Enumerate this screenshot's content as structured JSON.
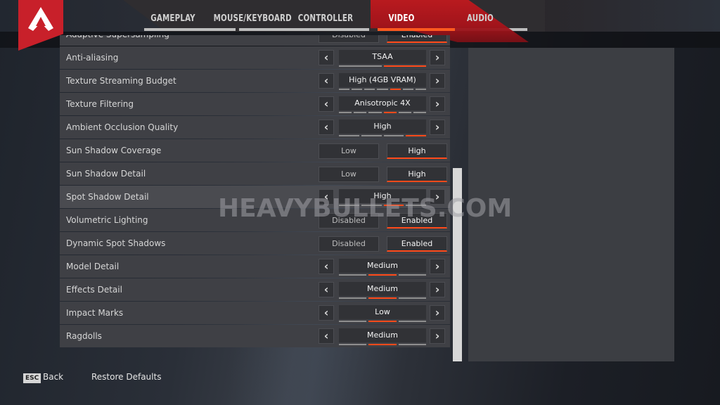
{
  "colors": {
    "accent": "#ff4a1a",
    "brand_red": "#c8202a",
    "row_bg": "#3f4045",
    "control_bg": "#313236"
  },
  "logo": {
    "icon": "apex-legends-logo"
  },
  "tabs": [
    {
      "label": "GAMEPLAY",
      "active": false
    },
    {
      "label": "MOUSE/KEYBOARD",
      "active": false
    },
    {
      "label": "CONTROLLER",
      "active": false
    },
    {
      "label": "VIDEO",
      "active": true
    },
    {
      "label": "AUDIO",
      "active": false
    }
  ],
  "settings": [
    {
      "label": "Adaptive Supersampling",
      "type": "toggle",
      "options": [
        "Disabled",
        "Enabled"
      ],
      "selected": 1
    },
    {
      "label": "Anti-aliasing",
      "type": "stepper",
      "value": "TSAA",
      "segments": 2,
      "selected": 2
    },
    {
      "label": "Texture Streaming Budget",
      "type": "stepper",
      "value": "High (4GB VRAM)",
      "segments": 7,
      "selected": 5
    },
    {
      "label": "Texture Filtering",
      "type": "stepper",
      "value": "Anisotropic 4X",
      "segments": 6,
      "selected": 4
    },
    {
      "label": "Ambient Occlusion Quality",
      "type": "stepper",
      "value": "High",
      "segments": 4,
      "selected": 4
    },
    {
      "label": "Sun Shadow Coverage",
      "type": "toggle",
      "options": [
        "Low",
        "High"
      ],
      "selected": 1
    },
    {
      "label": "Sun Shadow Detail",
      "type": "toggle",
      "options": [
        "Low",
        "High"
      ],
      "selected": 1
    },
    {
      "label": "Spot Shadow Detail",
      "type": "stepper",
      "value": "High",
      "segments": 4,
      "selected": 3,
      "hovered": true
    },
    {
      "label": "Volumetric Lighting",
      "type": "toggle",
      "options": [
        "Disabled",
        "Enabled"
      ],
      "selected": 1
    },
    {
      "label": "Dynamic Spot Shadows",
      "type": "toggle",
      "options": [
        "Disabled",
        "Enabled"
      ],
      "selected": 1
    },
    {
      "label": "Model Detail",
      "type": "stepper",
      "value": "Medium",
      "segments": 3,
      "selected": 2
    },
    {
      "label": "Effects Detail",
      "type": "stepper",
      "value": "Medium",
      "segments": 3,
      "selected": 2
    },
    {
      "label": "Impact Marks",
      "type": "stepper",
      "value": "Low",
      "segments": 3,
      "selected": 2
    },
    {
      "label": "Ragdolls",
      "type": "stepper",
      "value": "Medium",
      "segments": 3,
      "selected": 2
    }
  ],
  "scroll": {
    "position_fraction": 0.4,
    "visible_fraction": 0.6
  },
  "watermark": "HEAVYBULLETS.COM",
  "footer": {
    "esc_key": "ESC",
    "back_label": "Back",
    "restore_label": "Restore Defaults"
  }
}
